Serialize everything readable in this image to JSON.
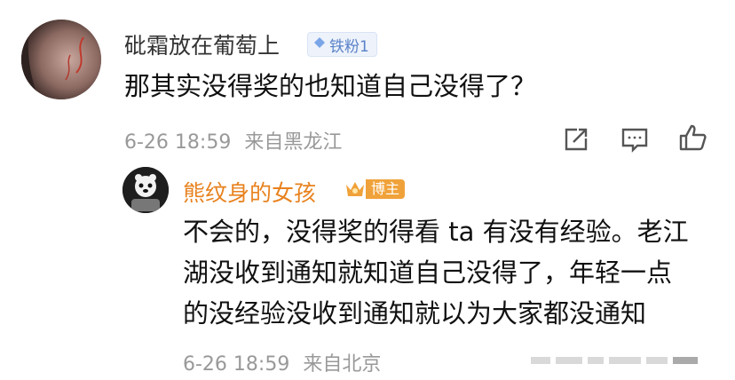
{
  "comment": {
    "username": "砒霜放在葡萄上",
    "badge": "铁粉1",
    "text": "那其实没得奖的也知道自己没得了？",
    "timestamp": "6-26 18:59",
    "location": "来自黑龙江",
    "actions": [
      "share-icon",
      "comment-icon",
      "like-icon"
    ]
  },
  "reply": {
    "username": "熊纹身的女孩",
    "badge": "博主",
    "lines": [
      "不会的，没得奖的得看 ta 有没有经验。老江",
      "湖没收到通知就知道自己没得了，年轻一点",
      "的没经验没收到通知就以为大家都没通知"
    ],
    "timestamp": "6-26 18:59",
    "location": "来自北京"
  },
  "colors": {
    "reply_username": "#e8821e",
    "badge_fan": "#5a82c8",
    "badge_blogger": "#f0a23a",
    "meta_text": "#999999"
  }
}
